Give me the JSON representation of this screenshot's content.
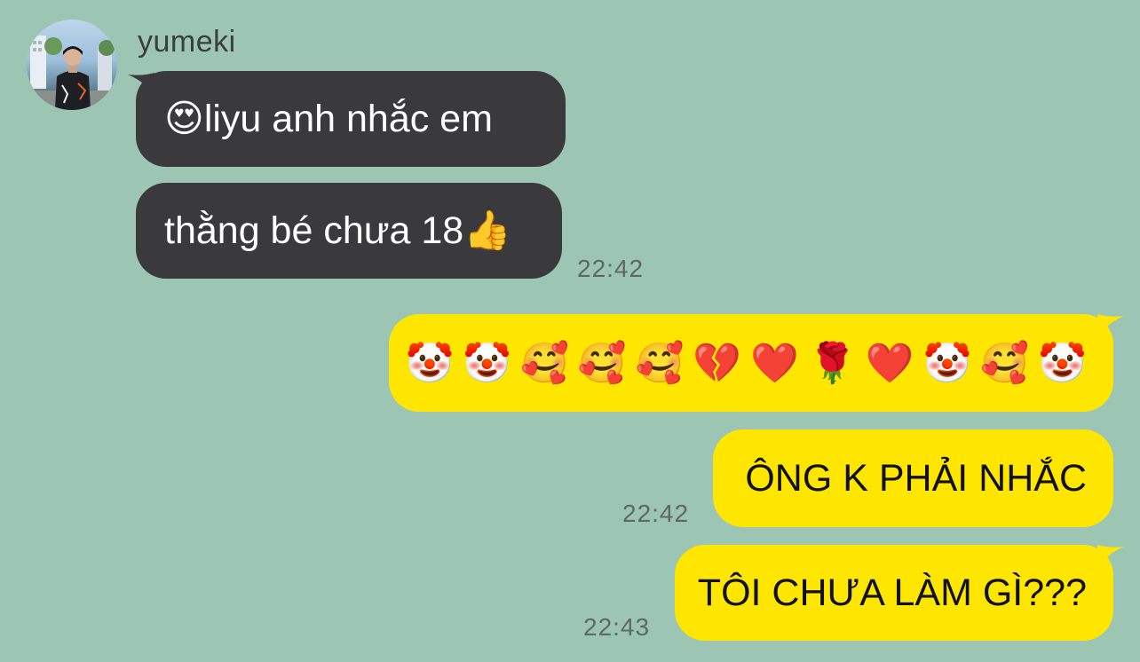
{
  "chat": {
    "sender": {
      "name": "yumeki"
    },
    "messages": [
      {
        "id": "m1",
        "side": "incoming",
        "emoji": "😍",
        "text": " liyu anh nhắc em",
        "time": ""
      },
      {
        "id": "m2",
        "side": "incoming",
        "text": "thằng bé chưa 18",
        "emoji_suffix": "👍",
        "time": "22:42"
      },
      {
        "id": "m3",
        "side": "outgoing",
        "emojis": [
          "🤡",
          "🤡",
          "🥰",
          "🥰",
          "🥰",
          "💔",
          "❤️",
          "🌹",
          "❤️",
          "🤡",
          "🥰",
          "🤡"
        ],
        "time": ""
      },
      {
        "id": "m4",
        "side": "outgoing",
        "text": "ÔNG K PHẢI NHẮC",
        "time": "22:42"
      },
      {
        "id": "m5",
        "side": "outgoing",
        "text": "TÔI CHƯA LÀM GÌ???",
        "time": "22:43"
      }
    ]
  },
  "colors": {
    "background": "#9cc6b3",
    "incoming_bubble": "#3a3a3c",
    "outgoing_bubble": "#ffe600",
    "timestamp": "#5c6a63"
  }
}
